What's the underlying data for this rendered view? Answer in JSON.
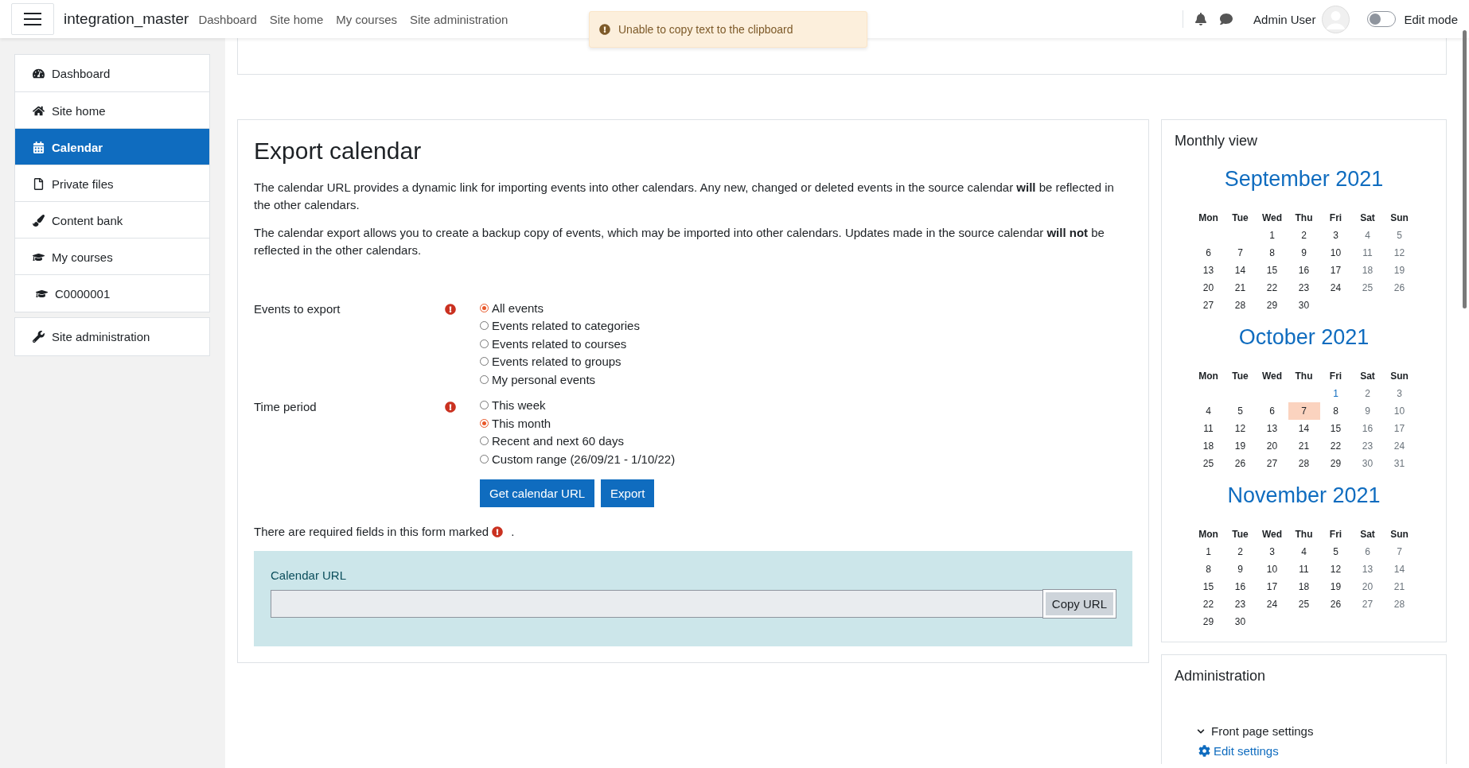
{
  "navbar": {
    "brand": "integration_master",
    "links": [
      "Dashboard",
      "Site home",
      "My courses",
      "Site administration"
    ],
    "user": "Admin User",
    "edit_mode": {
      "label": "Edit mode",
      "on": false
    }
  },
  "toast": {
    "message": "Unable to copy text to the clipboard"
  },
  "sidebar": {
    "items": [
      {
        "label": "Dashboard",
        "kind": "dashboard",
        "selected": false
      },
      {
        "label": "Site home",
        "kind": "home",
        "selected": false
      },
      {
        "label": "Calendar",
        "kind": "calendar",
        "selected": true
      },
      {
        "label": "Private files",
        "kind": "file",
        "selected": false
      },
      {
        "label": "Content bank",
        "kind": "brush",
        "selected": false
      },
      {
        "label": "My courses",
        "kind": "course",
        "selected": false,
        "children": [
          {
            "label": "C0000001",
            "kind": "course",
            "selected": false
          }
        ]
      }
    ],
    "admin_items": [
      {
        "label": "Site administration",
        "kind": "admin",
        "selected": false
      }
    ]
  },
  "export": {
    "title": "Export calendar",
    "paragraphs": [
      "The calendar URL provides a dynamic link for importing events into other calendars. Any new, changed or deleted events in the source calendar **will** be reflected in the other calendars.",
      "The calendar export allows you to create a backup copy of events, which may be imported into other calendars. Updates made in the source calendar **will not** be reflected in the other calendars."
    ],
    "groups": [
      {
        "label": "Events to export",
        "required": true,
        "options": [
          {
            "label": "All events",
            "selected": true
          },
          {
            "label": "Events related to categories",
            "selected": false
          },
          {
            "label": "Events related to courses",
            "selected": false
          },
          {
            "label": "Events related to groups",
            "selected": false
          },
          {
            "label": "My personal events",
            "selected": false
          }
        ]
      },
      {
        "label": "Time period",
        "required": true,
        "options": [
          {
            "label": "This week",
            "selected": false
          },
          {
            "label": "This month",
            "selected": true
          },
          {
            "label": "Recent and next 60 days",
            "selected": false
          },
          {
            "label": "Custom range (26/09/21 - 1/10/22)",
            "selected": false
          }
        ]
      }
    ],
    "buttons": [
      "Get calendar URL",
      "Export"
    ],
    "required_note": "There are required fields in this form marked",
    "required_note_end": ".",
    "url_box": {
      "label": "Calendar URL",
      "copy_button": "Copy URL"
    }
  },
  "monthly_view": {
    "title": "Monthly view",
    "months": [
      {
        "title": "September 2021",
        "weekdays": [
          "Mon",
          "Tue",
          "Wed",
          "Thu",
          "Fri",
          "Sat",
          "Sun"
        ],
        "weeks": [
          [
            {
              "kind": "blank"
            },
            {
              "kind": "blank"
            },
            {
              "kind": "day",
              "day": "1",
              "today": false,
              "event": false
            },
            {
              "kind": "day",
              "day": "2",
              "today": false,
              "event": false
            },
            {
              "kind": "day",
              "day": "3",
              "today": false,
              "event": false
            },
            {
              "kind": "weekend",
              "day": "4",
              "today": false,
              "event": false
            },
            {
              "kind": "weekend",
              "day": "5",
              "today": false,
              "event": false
            }
          ],
          [
            {
              "kind": "day",
              "day": "6",
              "today": false,
              "event": false
            },
            {
              "kind": "day",
              "day": "7",
              "today": false,
              "event": false
            },
            {
              "kind": "day",
              "day": "8",
              "today": false,
              "event": false
            },
            {
              "kind": "day",
              "day": "9",
              "today": false,
              "event": false
            },
            {
              "kind": "day",
              "day": "10",
              "today": false,
              "event": false
            },
            {
              "kind": "weekend",
              "day": "11",
              "today": false,
              "event": false
            },
            {
              "kind": "weekend",
              "day": "12",
              "today": false,
              "event": false
            }
          ],
          [
            {
              "kind": "day",
              "day": "13",
              "today": false,
              "event": false
            },
            {
              "kind": "day",
              "day": "14",
              "today": false,
              "event": false
            },
            {
              "kind": "day",
              "day": "15",
              "today": false,
              "event": false
            },
            {
              "kind": "day",
              "day": "16",
              "today": false,
              "event": false
            },
            {
              "kind": "day",
              "day": "17",
              "today": false,
              "event": false
            },
            {
              "kind": "weekend",
              "day": "18",
              "today": false,
              "event": false
            },
            {
              "kind": "weekend",
              "day": "19",
              "today": false,
              "event": false
            }
          ],
          [
            {
              "kind": "day",
              "day": "20",
              "today": false,
              "event": false
            },
            {
              "kind": "day",
              "day": "21",
              "today": false,
              "event": false
            },
            {
              "kind": "day",
              "day": "22",
              "today": false,
              "event": false
            },
            {
              "kind": "day",
              "day": "23",
              "today": false,
              "event": false
            },
            {
              "kind": "day",
              "day": "24",
              "today": false,
              "event": false
            },
            {
              "kind": "weekend",
              "day": "25",
              "today": false,
              "event": false
            },
            {
              "kind": "weekend",
              "day": "26",
              "today": false,
              "event": false
            }
          ],
          [
            {
              "kind": "day",
              "day": "27",
              "today": false,
              "event": false
            },
            {
              "kind": "day",
              "day": "28",
              "today": false,
              "event": false
            },
            {
              "kind": "day",
              "day": "29",
              "today": false,
              "event": false
            },
            {
              "kind": "day",
              "day": "30",
              "today": false,
              "event": false
            }
          ]
        ]
      },
      {
        "title": "October 2021",
        "weekdays": [
          "Mon",
          "Tue",
          "Wed",
          "Thu",
          "Fri",
          "Sat",
          "Sun"
        ],
        "weeks": [
          [
            {
              "kind": "blank"
            },
            {
              "kind": "blank"
            },
            {
              "kind": "blank"
            },
            {
              "kind": "blank"
            },
            {
              "kind": "day",
              "day": "1",
              "today": false,
              "event": true
            },
            {
              "kind": "weekend",
              "day": "2",
              "today": false,
              "event": false
            },
            {
              "kind": "weekend",
              "day": "3",
              "today": false,
              "event": false
            }
          ],
          [
            {
              "kind": "day",
              "day": "4",
              "today": false,
              "event": false
            },
            {
              "kind": "day",
              "day": "5",
              "today": false,
              "event": false
            },
            {
              "kind": "day",
              "day": "6",
              "today": false,
              "event": false
            },
            {
              "kind": "day",
              "day": "7",
              "today": true,
              "event": false
            },
            {
              "kind": "day",
              "day": "8",
              "today": false,
              "event": false
            },
            {
              "kind": "weekend",
              "day": "9",
              "today": false,
              "event": false
            },
            {
              "kind": "weekend",
              "day": "10",
              "today": false,
              "event": false
            }
          ],
          [
            {
              "kind": "day",
              "day": "11",
              "today": false,
              "event": false
            },
            {
              "kind": "day",
              "day": "12",
              "today": false,
              "event": false
            },
            {
              "kind": "day",
              "day": "13",
              "today": false,
              "event": false
            },
            {
              "kind": "day",
              "day": "14",
              "today": false,
              "event": false
            },
            {
              "kind": "day",
              "day": "15",
              "today": false,
              "event": false
            },
            {
              "kind": "weekend",
              "day": "16",
              "today": false,
              "event": false
            },
            {
              "kind": "weekend",
              "day": "17",
              "today": false,
              "event": false
            }
          ],
          [
            {
              "kind": "day",
              "day": "18",
              "today": false,
              "event": false
            },
            {
              "kind": "day",
              "day": "19",
              "today": false,
              "event": false
            },
            {
              "kind": "day",
              "day": "20",
              "today": false,
              "event": false
            },
            {
              "kind": "day",
              "day": "21",
              "today": false,
              "event": false
            },
            {
              "kind": "day",
              "day": "22",
              "today": false,
              "event": false
            },
            {
              "kind": "weekend",
              "day": "23",
              "today": false,
              "event": false
            },
            {
              "kind": "weekend",
              "day": "24",
              "today": false,
              "event": false
            }
          ],
          [
            {
              "kind": "day",
              "day": "25",
              "today": false,
              "event": false
            },
            {
              "kind": "day",
              "day": "26",
              "today": false,
              "event": false
            },
            {
              "kind": "day",
              "day": "27",
              "today": false,
              "event": false
            },
            {
              "kind": "day",
              "day": "28",
              "today": false,
              "event": false
            },
            {
              "kind": "day",
              "day": "29",
              "today": false,
              "event": false
            },
            {
              "kind": "weekend",
              "day": "30",
              "today": false,
              "event": false
            },
            {
              "kind": "weekend",
              "day": "31",
              "today": false,
              "event": false
            }
          ]
        ]
      },
      {
        "title": "November 2021",
        "weekdays": [
          "Mon",
          "Tue",
          "Wed",
          "Thu",
          "Fri",
          "Sat",
          "Sun"
        ],
        "weeks": [
          [
            {
              "kind": "day",
              "day": "1",
              "today": false,
              "event": false
            },
            {
              "kind": "day",
              "day": "2",
              "today": false,
              "event": false
            },
            {
              "kind": "day",
              "day": "3",
              "today": false,
              "event": false
            },
            {
              "kind": "day",
              "day": "4",
              "today": false,
              "event": false
            },
            {
              "kind": "day",
              "day": "5",
              "today": false,
              "event": false
            },
            {
              "kind": "weekend",
              "day": "6",
              "today": false,
              "event": false
            },
            {
              "kind": "weekend",
              "day": "7",
              "today": false,
              "event": false
            }
          ],
          [
            {
              "kind": "day",
              "day": "8",
              "today": false,
              "event": false
            },
            {
              "kind": "day",
              "day": "9",
              "today": false,
              "event": false
            },
            {
              "kind": "day",
              "day": "10",
              "today": false,
              "event": false
            },
            {
              "kind": "day",
              "day": "11",
              "today": false,
              "event": false
            },
            {
              "kind": "day",
              "day": "12",
              "today": false,
              "event": false
            },
            {
              "kind": "weekend",
              "day": "13",
              "today": false,
              "event": false
            },
            {
              "kind": "weekend",
              "day": "14",
              "today": false,
              "event": false
            }
          ],
          [
            {
              "kind": "day",
              "day": "15",
              "today": false,
              "event": false
            },
            {
              "kind": "day",
              "day": "16",
              "today": false,
              "event": false
            },
            {
              "kind": "day",
              "day": "17",
              "today": false,
              "event": false
            },
            {
              "kind": "day",
              "day": "18",
              "today": false,
              "event": false
            },
            {
              "kind": "day",
              "day": "19",
              "today": false,
              "event": false
            },
            {
              "kind": "weekend",
              "day": "20",
              "today": false,
              "event": false
            },
            {
              "kind": "weekend",
              "day": "21",
              "today": false,
              "event": false
            }
          ],
          [
            {
              "kind": "day",
              "day": "22",
              "today": false,
              "event": false
            },
            {
              "kind": "day",
              "day": "23",
              "today": false,
              "event": false
            },
            {
              "kind": "day",
              "day": "24",
              "today": false,
              "event": false
            },
            {
              "kind": "day",
              "day": "25",
              "today": false,
              "event": false
            },
            {
              "kind": "day",
              "day": "26",
              "today": false,
              "event": false
            },
            {
              "kind": "weekend",
              "day": "27",
              "today": false,
              "event": false
            },
            {
              "kind": "weekend",
              "day": "28",
              "today": false,
              "event": false
            }
          ],
          [
            {
              "kind": "day",
              "day": "29",
              "today": false,
              "event": false
            },
            {
              "kind": "day",
              "day": "30",
              "today": false,
              "event": false
            }
          ]
        ]
      }
    ]
  },
  "administration": {
    "title": "Administration",
    "tree": [
      {
        "label": "Front page settings",
        "kind": "folder",
        "expanded": true,
        "children": [
          {
            "label": "Edit settings",
            "kind": "link"
          }
        ]
      }
    ]
  }
}
